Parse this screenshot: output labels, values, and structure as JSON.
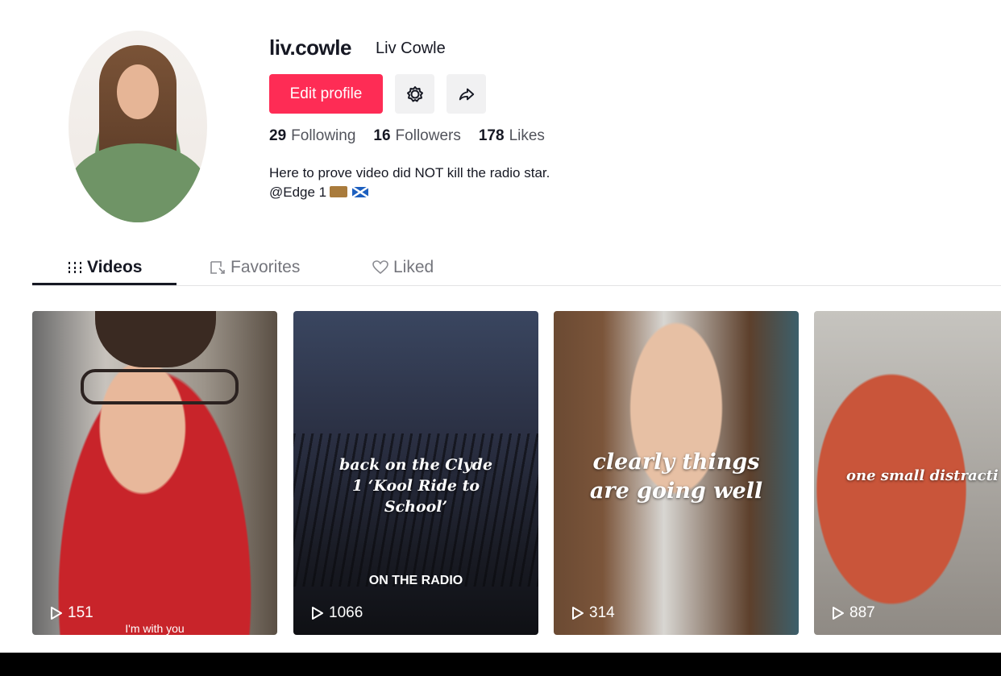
{
  "profile": {
    "username": "liv.cowle",
    "display_name": "Liv Cowle",
    "edit_label": "Edit profile",
    "stats": [
      {
        "value": "29",
        "label": "Following"
      },
      {
        "value": "16",
        "label": "Followers"
      },
      {
        "value": "178",
        "label": "Likes"
      }
    ],
    "bio_line1": "Here to prove video did NOT kill the radio star.",
    "bio_line2": "@Edge 1"
  },
  "tabs": [
    {
      "label": "Videos",
      "icon": "grid-icon"
    },
    {
      "label": "Favorites",
      "icon": "bookmark-icon"
    },
    {
      "label": "Liked",
      "icon": "heart-icon"
    }
  ],
  "videos": [
    {
      "views": "151",
      "caption": "",
      "subcaption": "I'm with you"
    },
    {
      "views": "1066",
      "caption": "back on the Clyde 1 ‘Kool Ride to School’",
      "subcaption": "ON THE RADIO"
    },
    {
      "views": "314",
      "caption": "clearly things are going well",
      "subcaption": ""
    },
    {
      "views": "887",
      "caption": "one small distracti",
      "subcaption": ""
    }
  ],
  "colors": {
    "accent": "#fe2c55",
    "text": "#161823"
  }
}
